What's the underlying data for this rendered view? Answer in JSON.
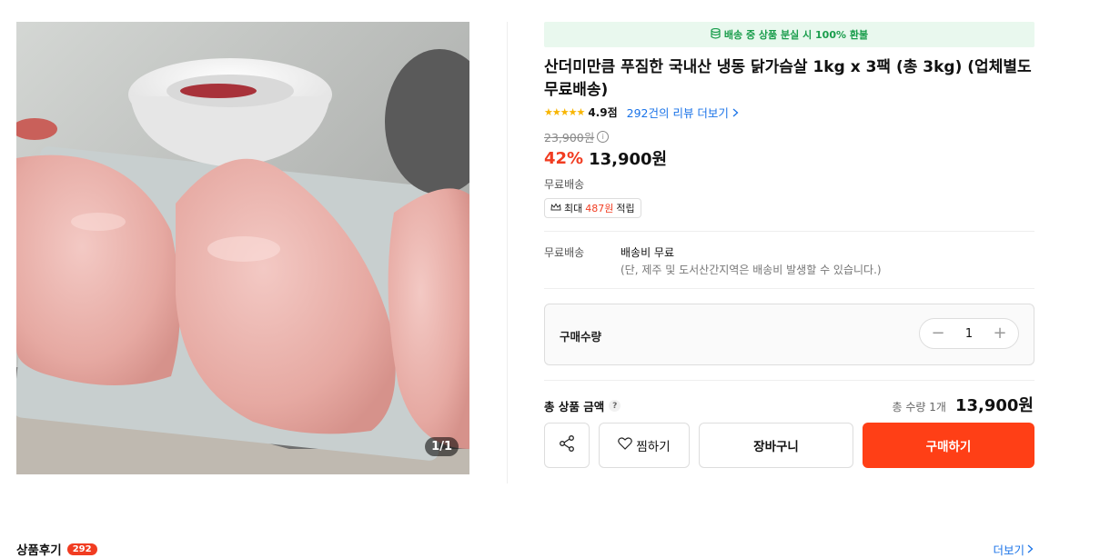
{
  "gallery": {
    "counter": "1/1"
  },
  "banner": {
    "icon": "coin-stack-icon",
    "text": "배송 중 상품 분실 시 100% 환불",
    "color": "#1a9d4c"
  },
  "product": {
    "title": "산더미만큼 푸짐한 국내산 냉동 닭가슴살 1kg x 3팩 (총 3kg) (업체별도 무료배송)",
    "rating_stars": "★★★★★",
    "rating_value": 5,
    "rating_score": "4.9점",
    "review_link": "292건의 리뷰 더보기",
    "original_price": "23,900원",
    "discount": "42%",
    "sale_price": "13,900원",
    "shipping_badge": "무료배송",
    "points": {
      "prefix": "최대",
      "amount": "487원",
      "suffix": "적립"
    }
  },
  "shipping": {
    "label": "무료배송",
    "fee": "배송비 무료",
    "note": "(단, 제주 및 도서산간지역은 배송비 발생할 수 있습니다.)"
  },
  "quantity": {
    "label": "구매수량",
    "value": "1",
    "minus": "−",
    "plus": "+"
  },
  "total": {
    "label": "총 상품 금액",
    "help": "?",
    "qty_text": "총 수량 1개",
    "price": "13,900원"
  },
  "actions": {
    "wish_label": "찜하기",
    "cart_label": "장바구니",
    "buy_label": "구매하기",
    "buy_color": "#ff3f16"
  },
  "reviews": {
    "title": "상품후기",
    "count": "292",
    "more": "더보기"
  }
}
